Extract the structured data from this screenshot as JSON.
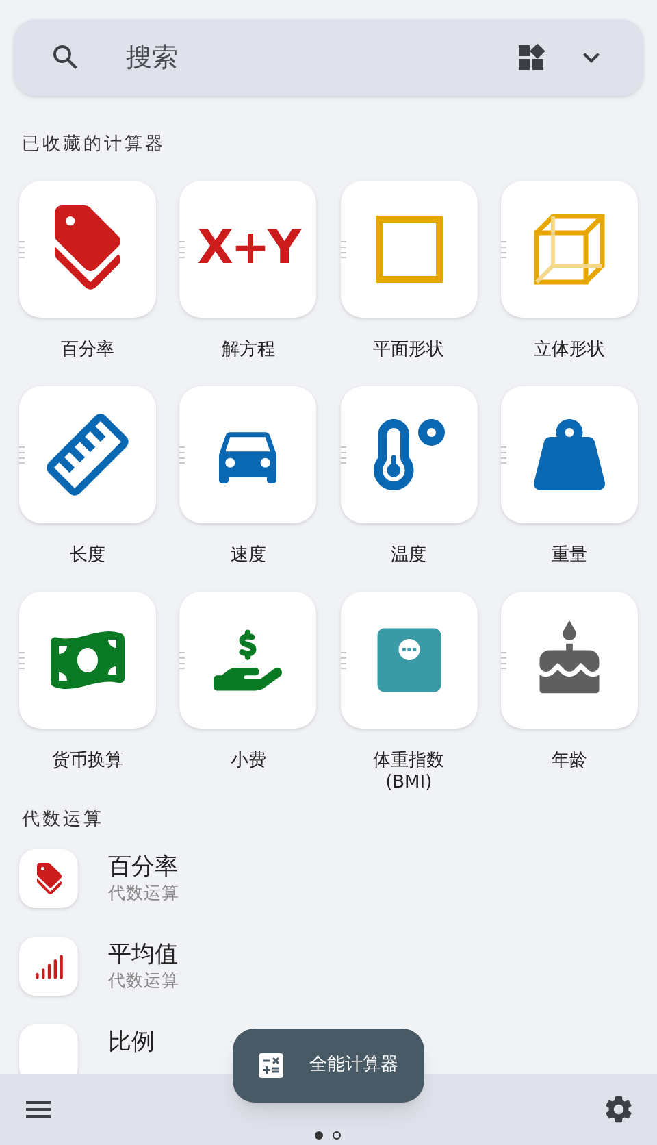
{
  "search": {
    "placeholder": "搜索"
  },
  "favorites": {
    "title": "已收藏的计算器",
    "items": [
      {
        "label": "百分率"
      },
      {
        "label": "解方程",
        "icon_text": "X+Y"
      },
      {
        "label": "平面形状"
      },
      {
        "label": "立体形状"
      },
      {
        "label": "长度"
      },
      {
        "label": "速度"
      },
      {
        "label": "温度"
      },
      {
        "label": "重量"
      },
      {
        "label": "货币换算"
      },
      {
        "label": "小费"
      },
      {
        "label": "体重指数\n(BMI)"
      },
      {
        "label": "年龄"
      }
    ]
  },
  "algebra": {
    "title": "代数运算",
    "items": [
      {
        "title": "百分率",
        "subtitle": "代数运算"
      },
      {
        "title": "平均值",
        "subtitle": "代数运算"
      },
      {
        "title": "比例"
      }
    ]
  },
  "fab": {
    "label": "全能计算器"
  },
  "pages": [
    {
      "selected": true
    },
    {
      "selected": false
    }
  ]
}
